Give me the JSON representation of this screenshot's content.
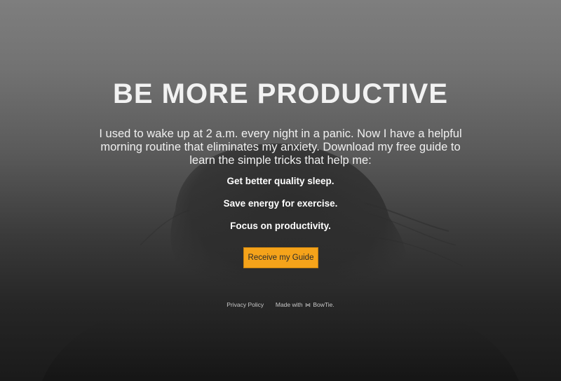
{
  "hero": {
    "headline": "BE MORE PRODUCTIVE",
    "intro": "I used to wake up at 2 a.m. every night in a panic. Now I have a helpful morning routine that eliminates my anxiety. Download my free guide to learn the simple tricks that help me:",
    "benefits": [
      "Get better quality sleep.",
      "Save energy for exercise.",
      "Focus on productivity."
    ],
    "cta_label": "Receive my Guide"
  },
  "footer": {
    "privacy_label": "Privacy Policy",
    "made_with_prefix": "Made with",
    "brand_icon": "bowtie-icon",
    "brand_label": "BowTie."
  },
  "colors": {
    "accent": "#f5a31a",
    "background_top": "#7e7e7e",
    "background_bottom": "#1a1a1a"
  }
}
